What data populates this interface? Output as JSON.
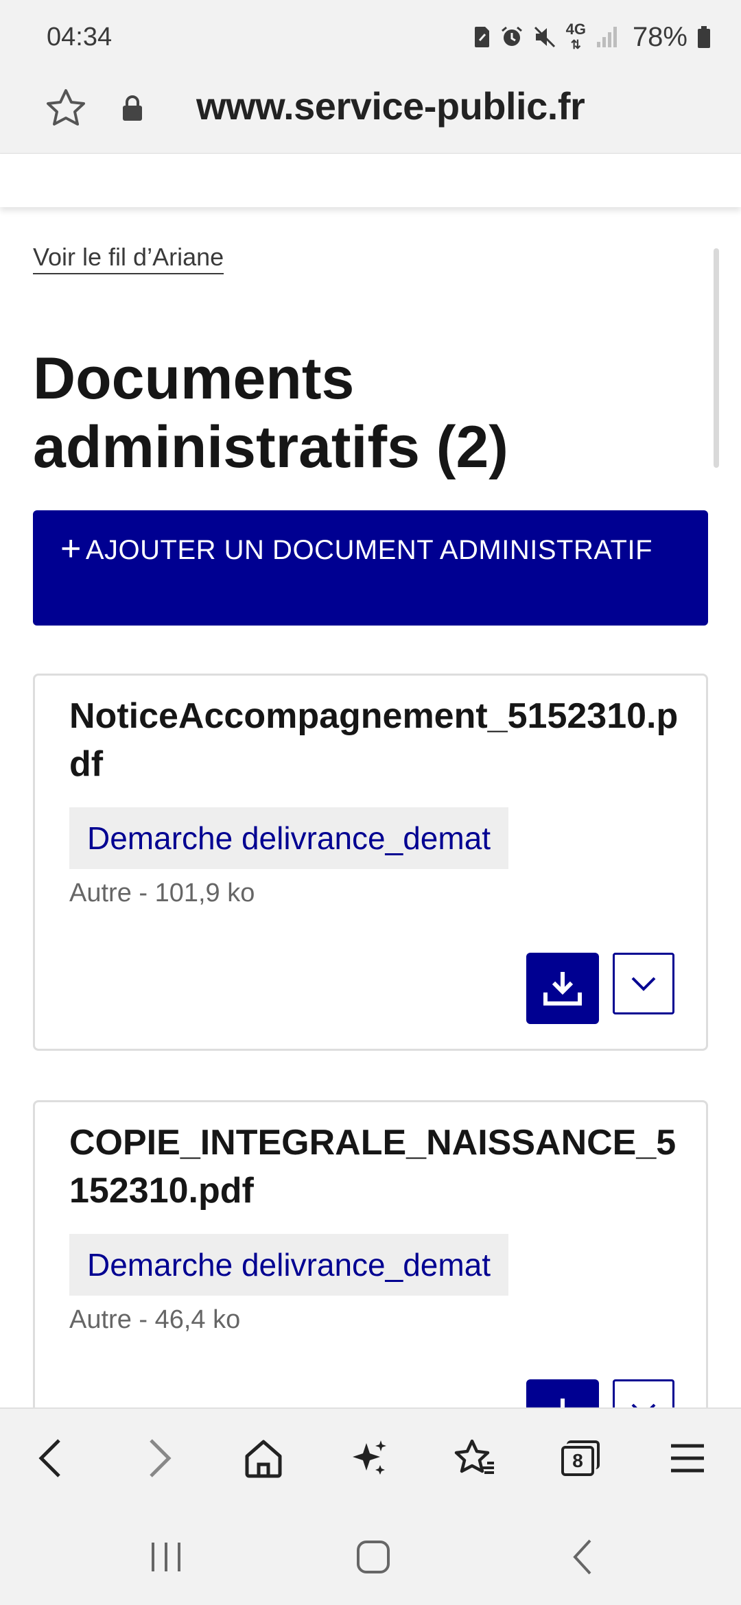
{
  "status_bar": {
    "time": "04:34",
    "network": "4G",
    "battery": "78%",
    "icons": [
      "sim-icon",
      "alarm-icon",
      "mute-icon",
      "network-4g-icon",
      "signal-icon",
      "battery-icon"
    ]
  },
  "browser": {
    "url": "www.service-public.fr",
    "icons": [
      "star-icon",
      "lock-icon",
      "reload-icon"
    ]
  },
  "page": {
    "breadcrumb_link": "Voir le fil d’Ariane",
    "title": "Documents administratifs (2)",
    "add_button_plus": "+",
    "add_button_label": "AJOUTER UN DOCUMENT ADMINISTRATIF",
    "documents": [
      {
        "name": "NoticeAccompagnement_5152310.pdf",
        "tag": "Demarche delivrance_demat",
        "meta": "Autre - 101,9 ko"
      },
      {
        "name": "COPIE_INTEGRALE_NAISSANCE_5152310.pdf",
        "tag": "Demarche delivrance_demat",
        "meta": "Autre - 46,4 ko"
      }
    ]
  },
  "toolbar": {
    "tabs_count": "8",
    "icons": [
      "back-icon",
      "forward-icon",
      "home-icon",
      "assistant-icon",
      "bookmarks-icon",
      "tabs-icon",
      "menu-icon"
    ]
  },
  "colors": {
    "primary": "#000091",
    "tag_bg": "#eeeeee",
    "chrome_bg": "#f2f2f2"
  }
}
